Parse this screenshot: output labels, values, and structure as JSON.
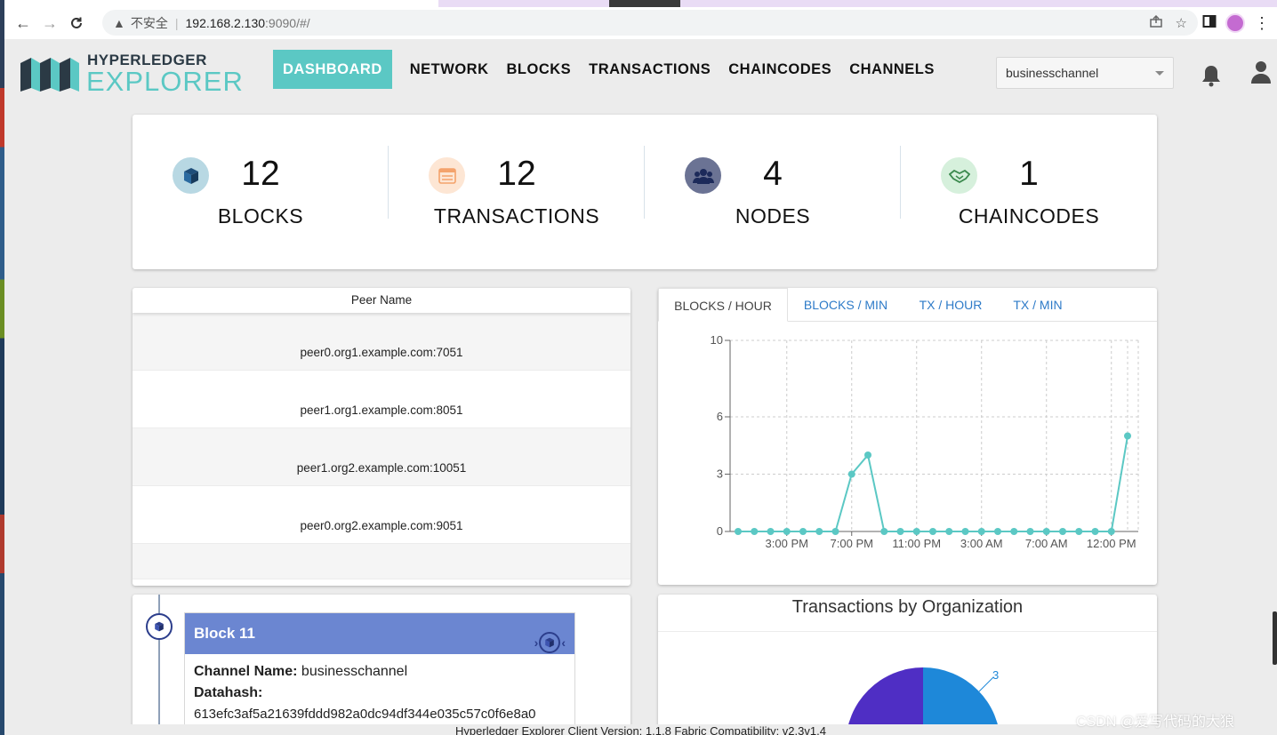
{
  "browser": {
    "insecure_label": "不安全",
    "url_host": "192.168.2.130",
    "url_rest": ":9090/#/"
  },
  "header": {
    "logo_line1": "HYPERLEDGER",
    "logo_line2": "EXPLORER",
    "nav": [
      {
        "label": "DASHBOARD"
      },
      {
        "label": "NETWORK"
      },
      {
        "label": "BLOCKS"
      },
      {
        "label": "TRANSACTIONS"
      },
      {
        "label": "CHAINCODES"
      },
      {
        "label": "CHANNELS"
      }
    ],
    "channel_selected": "businesschannel"
  },
  "stats": [
    {
      "count": "12",
      "label": "BLOCKS",
      "icon": "cube-icon",
      "color": "#b8d8e3"
    },
    {
      "count": "12",
      "label": "TRANSACTIONS",
      "icon": "list-icon",
      "color": "#fde6d4"
    },
    {
      "count": "4",
      "label": "NODES",
      "icon": "users-icon",
      "color": "#6b7394"
    },
    {
      "count": "1",
      "label": "CHAINCODES",
      "icon": "handshake-icon",
      "color": "#d6f0dc"
    }
  ],
  "peers": {
    "header": "Peer Name",
    "rows": [
      "peer0.org1.example.com:7051",
      "peer1.org1.example.com:8051",
      "peer1.org2.example.com:10051",
      "peer0.org2.example.com:9051"
    ]
  },
  "chart_tabs": [
    "BLOCKS / HOUR",
    "BLOCKS / MIN",
    "TX / HOUR",
    "TX / MIN"
  ],
  "chart_data": {
    "type": "line",
    "series": [
      {
        "values": [
          0,
          0,
          0,
          0,
          0,
          0,
          0,
          3,
          4,
          0,
          0,
          0,
          0,
          0,
          0,
          0,
          0,
          0,
          0,
          0,
          0,
          0,
          0,
          0,
          5
        ]
      }
    ],
    "x_tick_labels": [
      "3:00 PM",
      "7:00 PM",
      "11:00 PM",
      "3:00 AM",
      "7:00 AM",
      "12:00 PM"
    ],
    "y_ticks": [
      0,
      3,
      6,
      10
    ],
    "ylim": [
      0,
      10
    ],
    "grid": true,
    "color": "#5bc8c4"
  },
  "block": {
    "title": "Block 11",
    "channel_label": "Channel Name:",
    "channel_value": "businesschannel",
    "datahash_label": "Datahash:",
    "datahash_value": "613efc3af5a21639fddd982a0dc94df344e035c57c0f6e8a0"
  },
  "org_chart": {
    "title": "Transactions by Organization",
    "label_value": "3",
    "colors": [
      "#4f2ec4",
      "#1e88d9"
    ]
  },
  "footer": "Hyperledger Explorer Client Version: 1.1.8    Fabric Compatibility: v2.3v1.4",
  "watermark": "CSDN @爱写代码的大狼"
}
